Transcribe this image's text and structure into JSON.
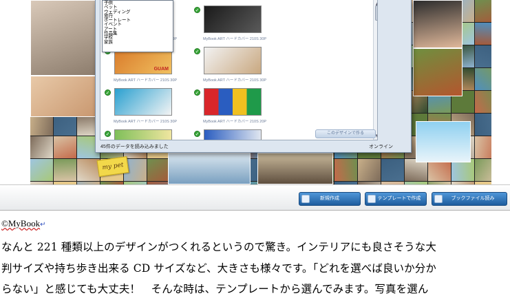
{
  "app": {
    "categories": [
      "子供",
      "ペット",
      "ウェディング",
      "旅行",
      "ポートレート",
      "イベント",
      "アート",
      "作品集",
      "学校",
      "家族"
    ],
    "thumbnails": [
      {
        "caption": "MyBook ART ハードカバー 210S 30P",
        "overlay_text": ""
      },
      {
        "caption": "MyBook ART ハードカバー 210S 30P",
        "overlay_text": ""
      },
      {
        "caption": "MyBook ART ハードカバー 210S 30P",
        "overlay_text": "GUAM"
      },
      {
        "caption": "MyBook ART ハードカバー 210S 30P",
        "overlay_text": ""
      },
      {
        "caption": "MyBook ART ハードカバー 210S 30P",
        "overlay_text": ""
      },
      {
        "caption": "MyBook ART ハードカバー 210S 20P",
        "overlay_text": ""
      }
    ],
    "create_design_button": "このデザインで作る",
    "status_loaded": "45件のデータを読み込みました",
    "status_online": "オンライン",
    "sticker_text": "my pet"
  },
  "toolbar": {
    "new_label": "新規作成",
    "template_label": "テンプレートで作成",
    "load_label": "ブックファイル読み"
  },
  "document": {
    "source_label": "©MyBook",
    "lines": [
      "なんと 221 種類以上のデザインがつくれるというので驚き。インテリアにも良さそうな大",
      "判サイズや持ち歩き出来る CD サイズなど、大きさも様々です。「どれを選べば良いか分か",
      "らない」と感じても大丈夫！　そんな時は、テンプレートから選んでみます。写真を選ん"
    ]
  },
  "colors": {
    "toolbar_button": "#1e5d9e",
    "caption_text": "#6d7d99",
    "check_badge": "#3aa53a"
  }
}
